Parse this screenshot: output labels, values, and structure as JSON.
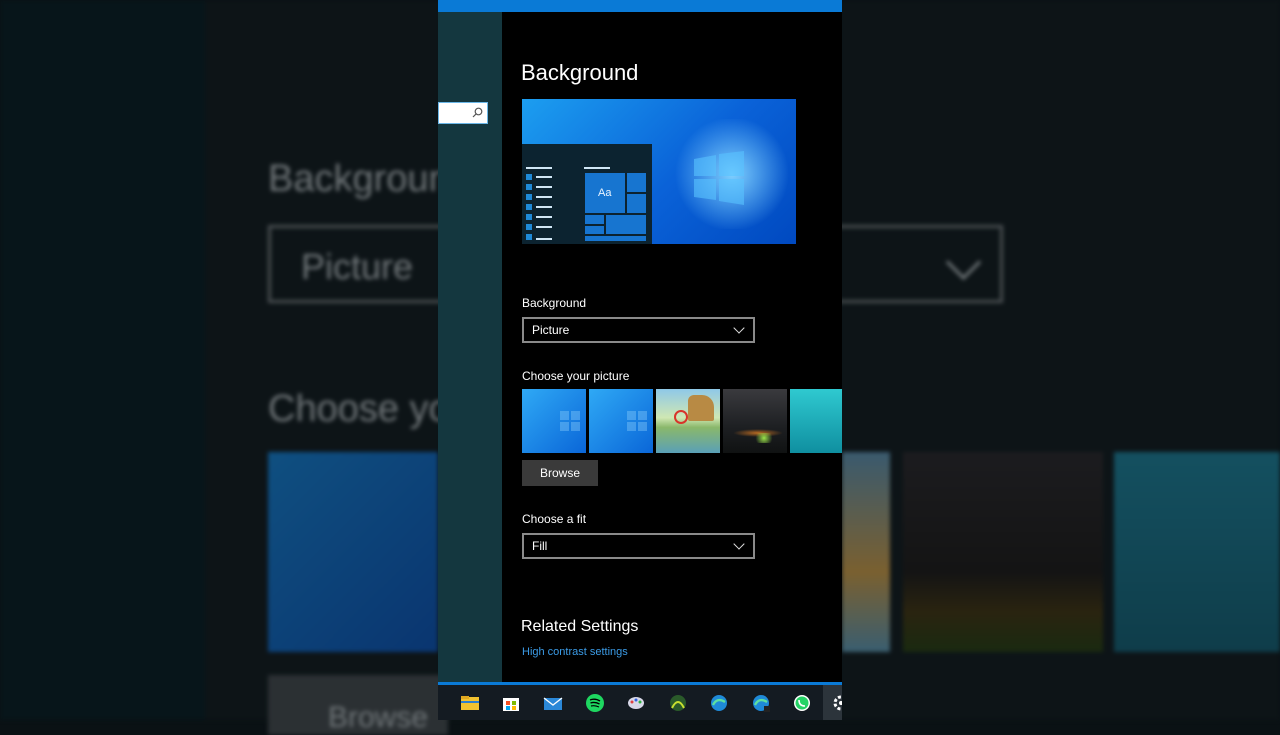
{
  "window": {
    "title": "Background"
  },
  "backdrop": {
    "title": "Backgroun",
    "select_value": "Picture",
    "choose_text": "Choose yo",
    "browse_text": "Browse"
  },
  "preview": {
    "sample_text": "Aa"
  },
  "background_section": {
    "label": "Background",
    "value": "Picture"
  },
  "choose_picture": {
    "label": "Choose your picture",
    "thumbnails": [
      "windows-blue-1",
      "windows-blue-2",
      "beach-rocks",
      "night-sky-tent",
      "underwater-turtle"
    ]
  },
  "browse_label": "Browse",
  "fit_section": {
    "label": "Choose a fit",
    "value": "Fill"
  },
  "related": {
    "title": "Related Settings",
    "link": "High contrast settings"
  },
  "taskbar": {
    "icons": [
      "file-explorer-icon",
      "store-icon",
      "mail-icon",
      "spotify-icon",
      "paint-icon",
      "xbox-icon",
      "edge-icon",
      "edge-beta-icon",
      "whatsapp-icon",
      "settings-icon"
    ]
  },
  "colors": {
    "accent": "#0a7ad6",
    "link": "#3b9be6",
    "nav": "#14373f"
  }
}
